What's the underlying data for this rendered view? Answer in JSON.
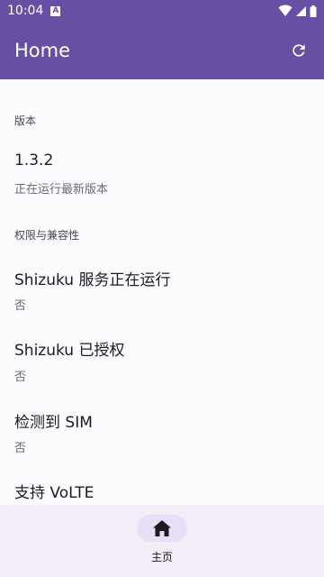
{
  "status_bar": {
    "time": "10:04",
    "notification_icon": "A"
  },
  "app_bar": {
    "title": "Home",
    "refresh_icon": "refresh-icon"
  },
  "sections": [
    {
      "header": "版本",
      "items": [
        {
          "title": "1.3.2",
          "summary": "正在运行最新版本"
        }
      ]
    },
    {
      "header": "权限与兼容性",
      "items": [
        {
          "title": "Shizuku 服务正在运行",
          "summary": "否"
        },
        {
          "title": "Shizuku 已授权",
          "summary": "否"
        },
        {
          "title": "检测到 SIM",
          "summary": "否"
        },
        {
          "title": "支持 VoLTE",
          "summary": ""
        }
      ]
    }
  ],
  "bottom_nav": {
    "items": [
      {
        "label": "主页",
        "icon": "home-icon",
        "selected": true
      }
    ]
  },
  "colors": {
    "primary": "#6750a4",
    "surface": "#fefbff",
    "nav_background": "#f3edf7",
    "nav_indicator": "#e8def8"
  }
}
